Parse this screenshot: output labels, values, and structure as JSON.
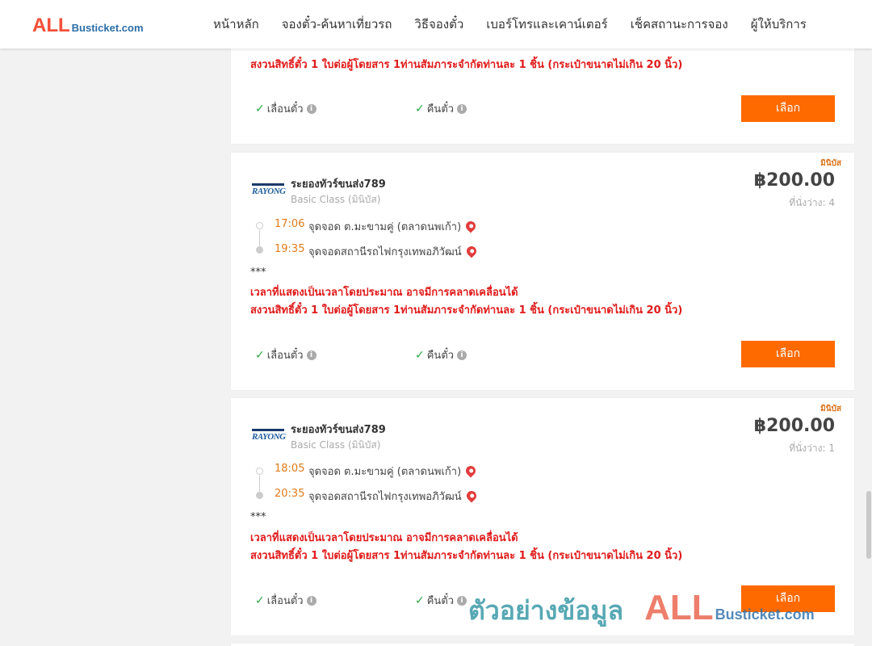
{
  "header": {
    "logo": {
      "main": "ALL",
      "sub": "Busticket.com"
    },
    "nav": [
      "หน้าหลัก",
      "จองตั๋ว-ค้นหาเที่ยวรถ",
      "วิธีจองตั๋ว",
      "เบอร์โทรและเคาน์เตอร์",
      "เช็คสถานะการจอง",
      "ผู้ให้บริการ"
    ]
  },
  "card_top": {
    "note2": "สงวนสิทธิ์ตั๋ว 1 ใบต่อผู้โดยสาร 1ท่านสัมภาระจำกัดท่านละ 1 ชิ้น (กระเป๋าขนาดไม่เกิน 20 นิ้ว)",
    "change": "เลื่อนตั๋ว",
    "refund": "คืนตั๋ว",
    "select": "เลือก"
  },
  "cards": [
    {
      "badge": "มินิบัส",
      "logo_text": "RAYONG",
      "operator": "ระยองทัวร์ขนส่ง789",
      "class": "Basic Class (มินิบัส)",
      "price": "฿200.00",
      "seats": "ที่นั่งว่าง: 4",
      "dep_time": "17:06",
      "dep_place": "จุดจอด ต.มะขามคู่ (ตลาดนพเก้า)",
      "arr_time": "19:35",
      "arr_place": "จุดจอดสถานีรถไฟกรุงเทพอภิวัฒน์",
      "stars": "***",
      "note1": "เวลาที่แสดงเป็นเวลาโดยประมาณ อาจมีการคลาดเคลื่อนได้",
      "note2": "สงวนสิทธิ์ตั๋ว 1 ใบต่อผู้โดยสาร 1ท่านสัมภาระจำกัดท่านละ 1 ชิ้น (กระเป๋าขนาดไม่เกิน 20 นิ้ว)",
      "change": "เลื่อนตั๋ว",
      "refund": "คืนตั๋ว",
      "select": "เลือก"
    },
    {
      "badge": "มินิบัส",
      "logo_text": "RAYONG",
      "operator": "ระยองทัวร์ขนส่ง789",
      "class": "Basic Class (มินิบัส)",
      "price": "฿200.00",
      "seats": "ที่นั่งว่าง: 1",
      "dep_time": "18:05",
      "dep_place": "จุดจอด ต.มะขามคู่ (ตลาดนพเก้า)",
      "arr_time": "20:35",
      "arr_place": "จุดจอดสถานีรถไฟกรุงเทพอภิวัฒน์",
      "stars": "***",
      "note1": "เวลาที่แสดงเป็นเวลาโดยประมาณ อาจมีการคลาดเคลื่อนได้",
      "note2": "สงวนสิทธิ์ตั๋ว 1 ใบต่อผู้โดยสาร 1ท่านสัมภาระจำกัดท่านละ 1 ชิ้น (กระเป๋าขนาดไม่เกิน 20 นิ้ว)",
      "change": "เลื่อนตั๋ว",
      "refund": "คืนตั๋ว",
      "select": "เลือก"
    }
  ],
  "watermark": {
    "thai": "ตัวอย่างข้อมูล",
    "main": "ALL",
    "sub": "Busticket.com"
  },
  "colors": {
    "accent": "#ff6a00",
    "time": "#e07b1a",
    "note": "#e01b1b",
    "check": "#28a745"
  }
}
